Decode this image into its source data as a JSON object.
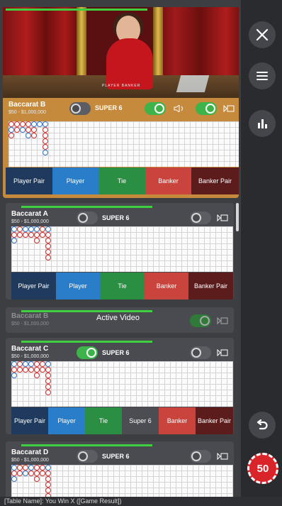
{
  "tables": [
    {
      "name": "Baccarat B",
      "limits": "$50 - $1,000,000",
      "super6_label": "SUPER 6"
    },
    {
      "name": "Baccarat A",
      "limits": "$50 - $1,000,000",
      "super6_label": "SUPER 6"
    },
    {
      "name": "Baccarat B",
      "limits": "$50 - $1,000,000",
      "status_label": "Active Video"
    },
    {
      "name": "Baccarat C",
      "limits": "$50 - $1,000,000",
      "super6_label": "SUPER 6"
    },
    {
      "name": "Baccarat D",
      "limits": "$50 - $1,000,000",
      "super6_label": "SUPER 6"
    }
  ],
  "bets_5": [
    "Player Pair",
    "Player",
    "Tie",
    "Banker",
    "Banker Pair"
  ],
  "bets_6": [
    "Player Pair",
    "Player",
    "Tie",
    "Super 6",
    "Banker",
    "Banker Pair"
  ],
  "video": {
    "sign": "PLAYER  BANKER"
  },
  "rail": {
    "close_icon": "close-icon",
    "menu_icon": "menu-icon",
    "stats_icon": "bar-chart-icon",
    "undo_icon": "undo-icon",
    "chip_value": "50"
  },
  "status_bar": {
    "text": "[Table Name]: You Win X ([Game Result])"
  },
  "colors": {
    "player": "#2a7ec9",
    "banker": "#c8443d",
    "tie": "#2a8e43",
    "toggle_on": "#3cb44a",
    "active_card": "#c58a3c"
  }
}
